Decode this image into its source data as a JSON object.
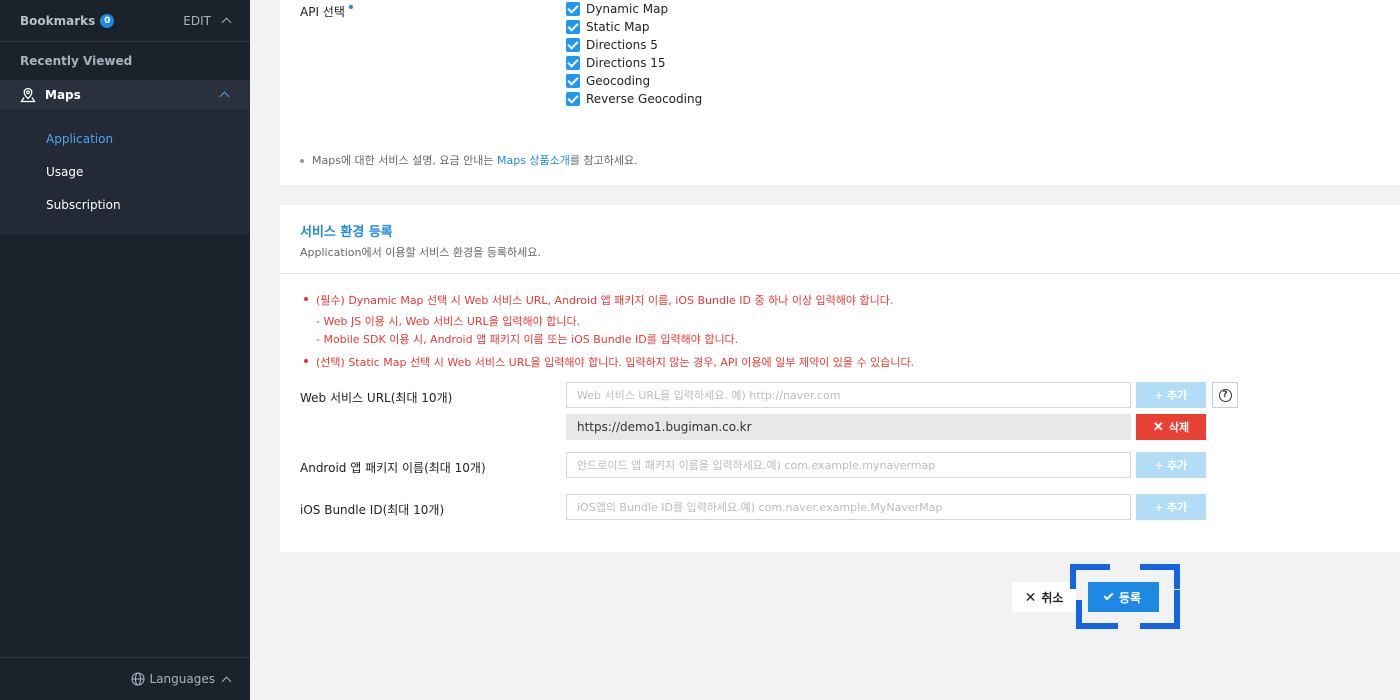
{
  "sidebar": {
    "bookmarks": {
      "label": "Bookmarks",
      "count": "0",
      "edit_label": "EDIT"
    },
    "recently_viewed": "Recently Viewed",
    "maps": {
      "label": "Maps"
    },
    "sub_items": [
      {
        "label": "Application",
        "active": true
      },
      {
        "label": "Usage"
      },
      {
        "label": "Subscription"
      }
    ],
    "languages": "Languages"
  },
  "api": {
    "label": "API 선택",
    "options": [
      "Dynamic Map",
      "Static Map",
      "Directions 5",
      "Directions 15",
      "Geocoding",
      "Reverse Geocoding"
    ],
    "note_prefix": "Maps에 대한 서비스 설명, 요금 안내는 ",
    "note_link": "Maps 상품소개",
    "note_suffix": "를 참고하세요."
  },
  "env": {
    "title": "서비스 환경 등록",
    "description": "Application에서 이용할 서비스 환경을 등록하세요.",
    "notes": {
      "required": "(필수) Dynamic Map 선택 시 Web 서비스 URL, Android 앱 패키지 이름, iOS Bundle ID 중 하나 이상 입력해야 합니다.",
      "sub1": "- Web JS 이용 시, Web 서비스 URL을 입력해야 합니다.",
      "sub2": "- Mobile SDK 이용 시, Android 앱 패키지 이름 또는 iOS Bundle ID를 입력해야 합니다.",
      "optional": "(선택) Static Map 선택 시 Web 서비스 URL을 입력해야 합니다. 입력하지 않는 경우, API 이용에 일부 제약이 있을 수 있습니다."
    },
    "web_url": {
      "label": "Web 서비스 URL(최대 10개)",
      "placeholder": "Web 서비스 URL을 입력하세요. 예) http://naver.com",
      "registered": "https://demo1.bugiman.co.kr"
    },
    "android": {
      "label": "Android 앱 패키지 이름(최대 10개)",
      "placeholder": "안드로이드 앱 패키지 이름을 입력하세요.예) com.example.mynavermap"
    },
    "ios": {
      "label": "iOS Bundle ID(최대 10개)",
      "placeholder": "iOS앱의 Bundle ID를 입력하세요.예) com.naver.example.MyNaverMap"
    },
    "add_label": "추가",
    "delete_label": "삭제",
    "help_glyph": "?"
  },
  "actions": {
    "cancel": "취소",
    "submit": "등록"
  },
  "colors": {
    "accent": "#1e88e5",
    "danger": "#e84133",
    "sidebar_bg": "#1c222c"
  }
}
